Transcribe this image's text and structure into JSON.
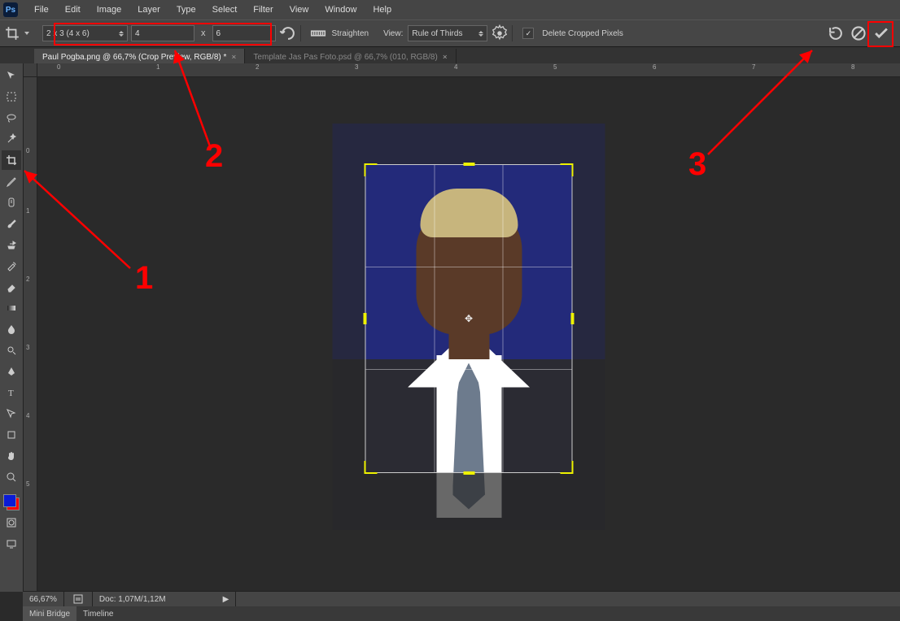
{
  "app": {
    "logo": "Ps"
  },
  "menu": [
    "File",
    "Edit",
    "Image",
    "Layer",
    "Type",
    "Select",
    "Filter",
    "View",
    "Window",
    "Help"
  ],
  "options": {
    "preset": "2 x 3 (4 x 6)",
    "width": "4",
    "height": "6",
    "straighten": "Straighten",
    "view_label": "View:",
    "overlay": "Rule of Thirds",
    "delete_cropped": "Delete Cropped Pixels"
  },
  "tabs": [
    {
      "label": "Paul Pogba.png @ 66,7% (Crop Preview, RGB/8) *"
    },
    {
      "label": "Template Jas Pas Foto.psd @ 66,7% (010, RGB/8)"
    }
  ],
  "ruler_h": [
    "0",
    "1",
    "2",
    "3",
    "4",
    "5",
    "6",
    "7",
    "8"
  ],
  "ruler_v": [
    "0",
    "1",
    "2",
    "3",
    "4",
    "5"
  ],
  "status": {
    "zoom": "66,67%",
    "doc": "Doc: 1,07M/1,12M"
  },
  "panels": [
    {
      "label": "Mini Bridge"
    },
    {
      "label": "Timeline"
    }
  ],
  "colors": {
    "fg": "#0b1bd6",
    "bg": "#ff0000"
  },
  "annotations": {
    "n1": "1",
    "n2": "2",
    "n3": "3"
  }
}
